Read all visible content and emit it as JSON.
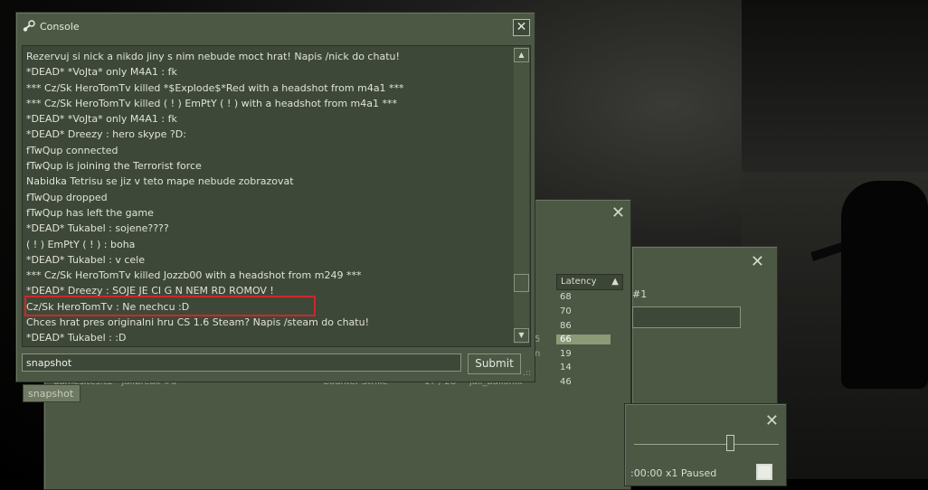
{
  "console": {
    "title": "Console",
    "close_label": "✕",
    "lines": [
      "Rezervuj si nick a nikdo jiny s nim nebude moct hrat! Napis /nick do chatu!",
      "*DEAD* *VoJta* only M4A1 : fk",
      "*** Cz/Sk HeroTomTv killed *$Explode$*Red with a headshot from m4a1 ***",
      "*** Cz/Sk HeroTomTv killed ( ! ) EmPtY ( ! ) with a headshot from m4a1 ***",
      "*DEAD* *VoJta* only M4A1 : fk",
      "*DEAD* Dreezy : hero skype ?D:",
      "fTwQup connected",
      "fTwQup is joining the Terrorist force",
      "Nabidka Tetrisu se jiz v teto mape nebude zobrazovat",
      "fTwQup dropped",
      "fTwQup has left the game",
      "*DEAD* Tukabel : sojene????",
      "( ! ) EmPtY ( ! ) : boha",
      "*DEAD* Tukabel : v cele",
      "*** Cz/Sk HeroTomTv killed Jozzb00 with a headshot from m249 ***",
      "*DEAD* Dreezy : SOJE JE CI G N NEM RD ROMOV !",
      "Cz/Sk HeroTomTv : Ne nechcu :D",
      "Chces hrat pres originalni hru CS 1.6 Steam? Napis /steam do chatu!",
      "*DEAD* Tukabel : :D"
    ],
    "highlighted_line_index": 15,
    "input_value": "snapshot",
    "submit_label": "Submit",
    "autocomplete_suggestion": "snapshot"
  },
  "server_browser": {
    "latency_header": "Latency",
    "latencies": [
      "68",
      "70",
      "86",
      "66",
      "19",
      "14",
      "46"
    ],
    "selected_row_index": 3,
    "partial_row": {
      "name": "gamesites.cz - Jailbreak #6",
      "game": "Counter-Strike",
      "players": "17 / 28",
      "map": "jail_balionix"
    },
    "side_fragments": [
      "5",
      "n"
    ],
    "close_label": "✕"
  },
  "info_panel": {
    "label": "#1",
    "close_label": "✕"
  },
  "demo_player": {
    "status_text": ":00:00  x1  Paused",
    "position": 0.66,
    "close_label": "✕"
  },
  "colors": {
    "panel": "#4c5844",
    "panel_inner": "#3e4838",
    "highlight": "#d0262b",
    "selected_row": "#8c9a78"
  },
  "icons": {
    "console_title": "steam-logo-icon",
    "close": "close-icon",
    "scroll_up": "chevron-up-icon",
    "scroll_down": "chevron-down-icon",
    "resize": "resize-grip-icon"
  }
}
